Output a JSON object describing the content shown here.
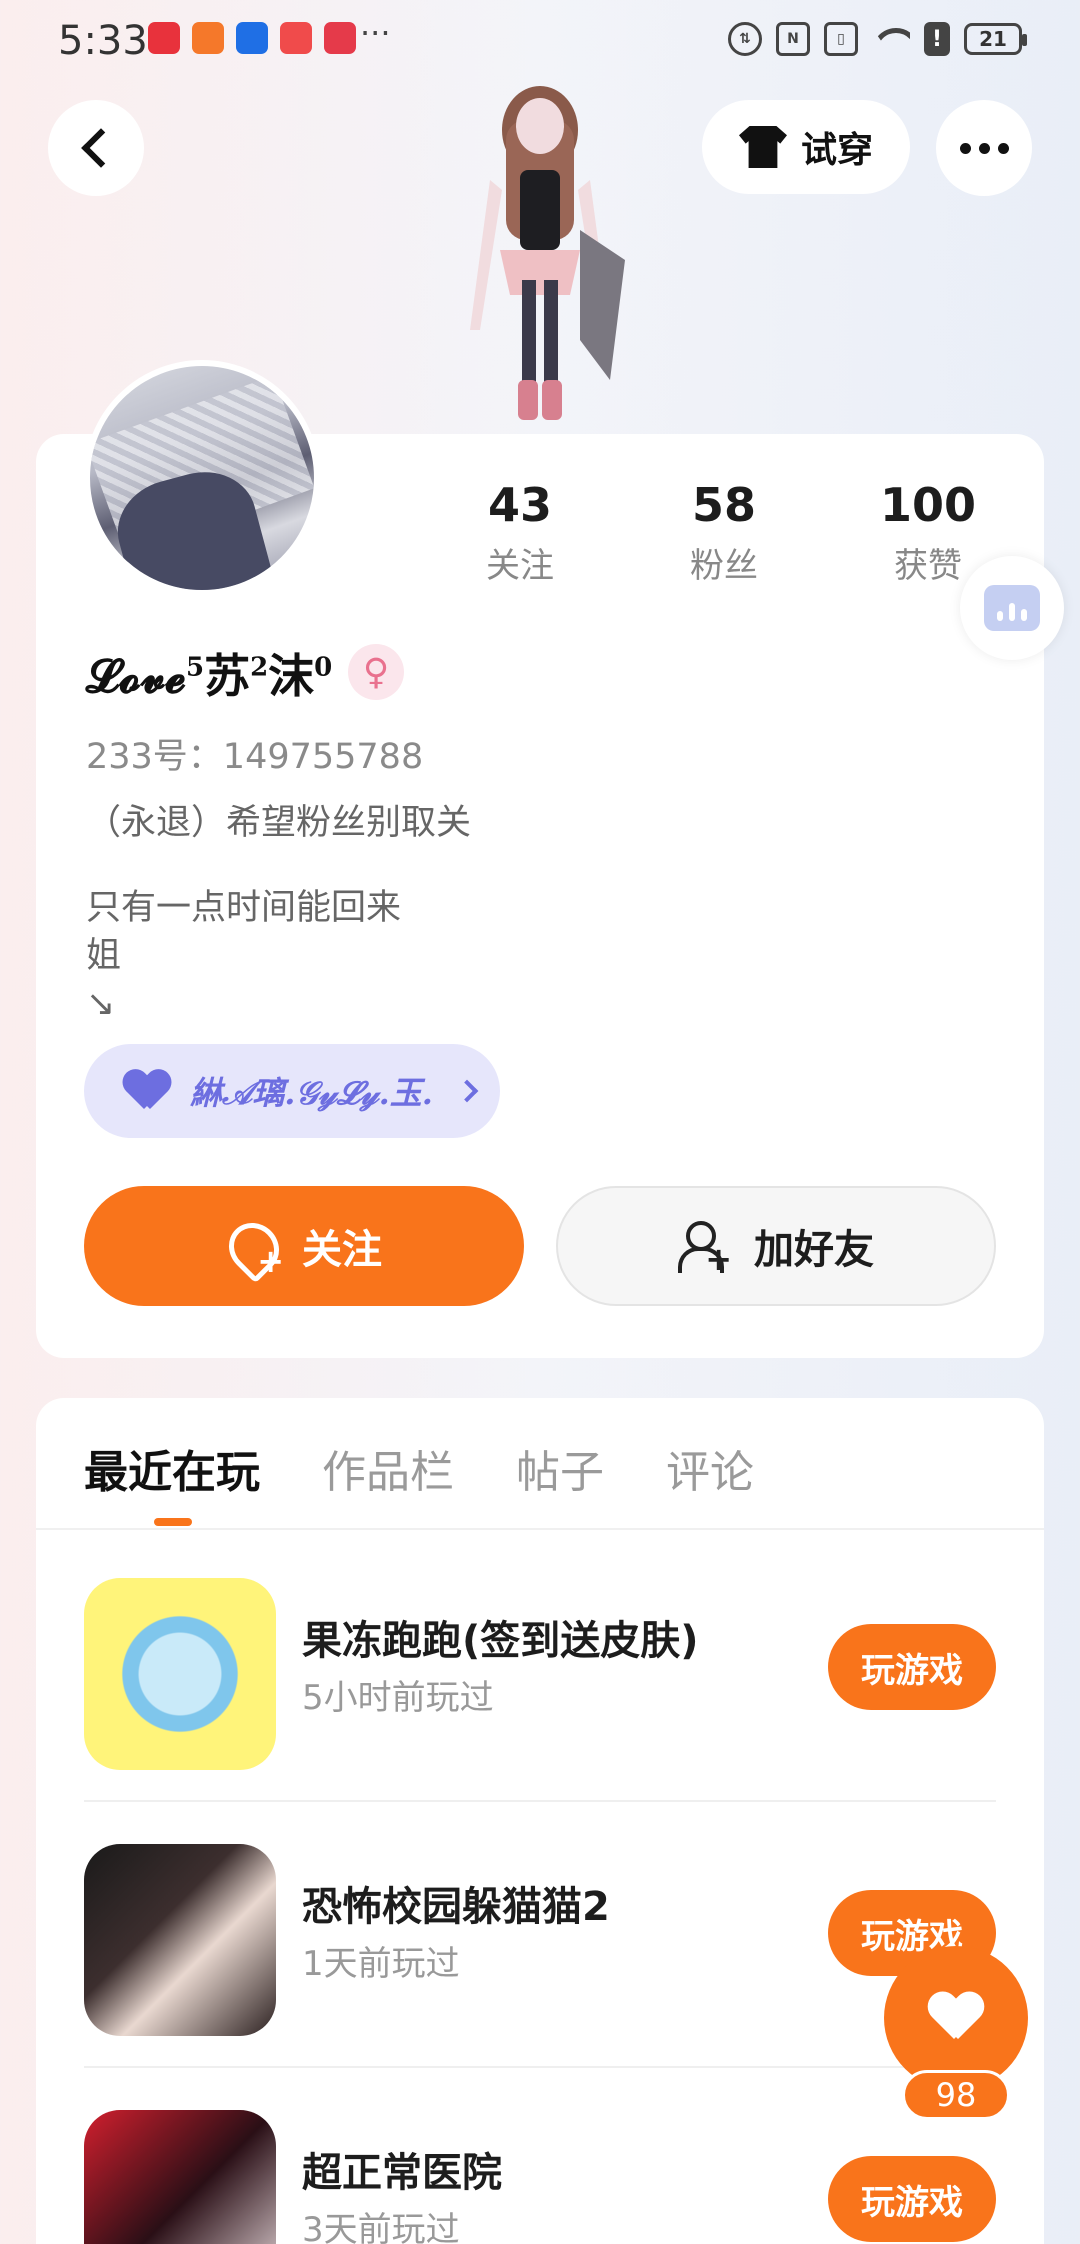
{
  "status_bar": {
    "time": "5:33",
    "more": "···",
    "battery": "21",
    "app_icon_colors": [
      "#e8323c",
      "#f5782a",
      "#1f6fe5",
      "#f04b4b",
      "#e53a4a"
    ]
  },
  "top_bar": {
    "try_on_label": "试穿"
  },
  "profile": {
    "nickname_prefix": "𝓛𝓸𝓿𝓮",
    "sup1": "5",
    "name_part1": "苏",
    "sup2": "2",
    "name_part2": "沫",
    "sup3": "0",
    "gender_symbol": "♀",
    "uid": "233号：149755788",
    "bio_line": "（永退）希望粉丝别取关",
    "bio_text": "只有一点时间能回来\n姐\n↘",
    "intimacy_label": "綝𝒜璃.𝒢𝓎𝓛𝓎.玉."
  },
  "stats": [
    {
      "value": "43",
      "label": "关注"
    },
    {
      "value": "58",
      "label": "粉丝"
    },
    {
      "value": "100",
      "label": "获赞"
    }
  ],
  "actions": {
    "follow_label": "关注",
    "add_friend_label": "加好友"
  },
  "tabs": [
    "最近在玩",
    "作品栏",
    "帖子",
    "评论"
  ],
  "games": [
    {
      "title": "果冻跑跑(签到送皮肤)",
      "meta": "5小时前玩过",
      "button": "玩游戏"
    },
    {
      "title": "恐怖校园躲猫猫2",
      "meta": "1天前玩过",
      "button": "玩游戏"
    },
    {
      "title": "超正常医院",
      "meta": "3天前玩过",
      "button": "玩游戏"
    }
  ],
  "like_count": "98",
  "colors": {
    "accent": "#f9741b",
    "intimacy": "#6d6ee0",
    "gender": "#e9718e"
  }
}
